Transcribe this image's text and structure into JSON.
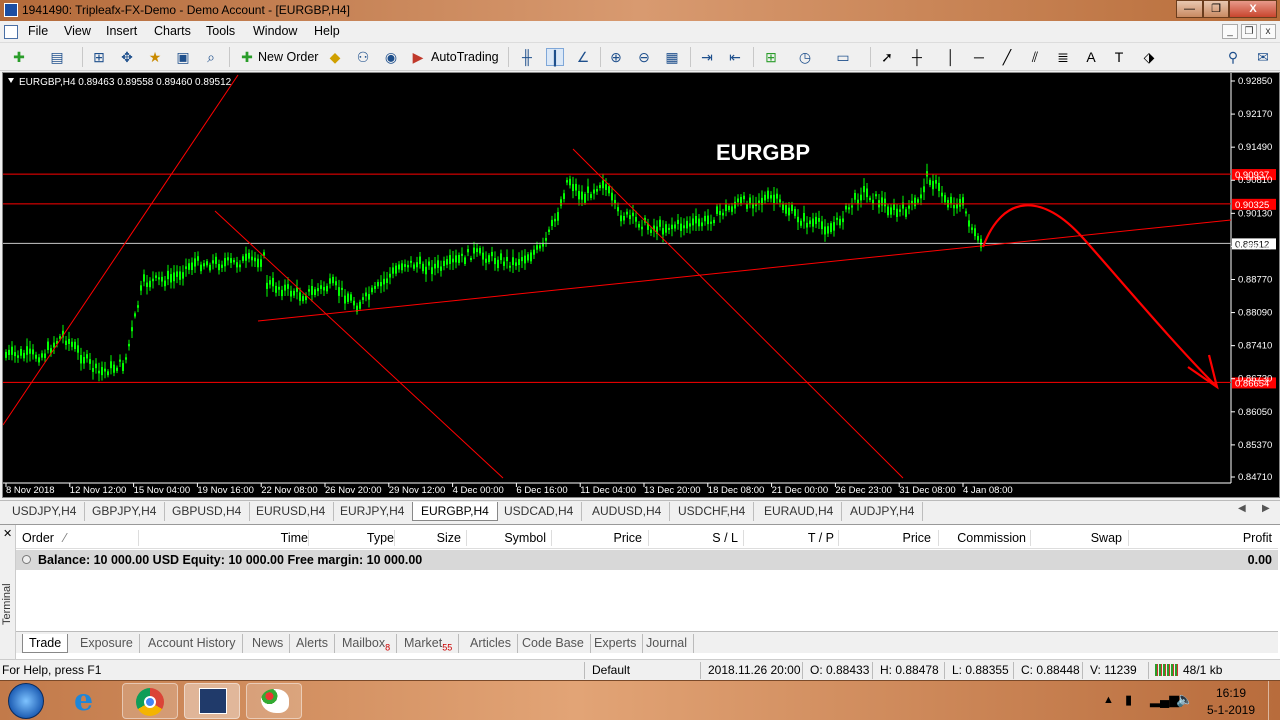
{
  "window": {
    "title": "1941490: Tripleafx-FX-Demo - Demo Account - [EURGBP,H4]",
    "min": "—",
    "max": "❐",
    "close": "X"
  },
  "menu": {
    "file": "File",
    "view": "View",
    "insert": "Insert",
    "charts": "Charts",
    "tools": "Tools",
    "window": "Window",
    "help": "Help"
  },
  "toolbar": {
    "new_order": "New Order",
    "autotrading": "AutoTrading"
  },
  "chart": {
    "header": "EURGBP,H4  0.89463 0.89558 0.89460 0.89512",
    "watermark": "EURGBP",
    "price_labels": [
      "0.92850",
      "0.92170",
      "0.91490",
      "0.90810",
      "0.90130",
      "0.89450",
      "0.88770",
      "0.88090",
      "0.87410",
      "0.86730",
      "0.86050",
      "0.85370",
      "0.84710"
    ],
    "hline_labels": [
      "0.90937",
      "0.90325",
      "0.89512",
      "0.86654"
    ],
    "time_labels": [
      "8 Nov 2018",
      "12 Nov 12:00",
      "15 Nov 04:00",
      "19 Nov 16:00",
      "22 Nov 08:00",
      "26 Nov 20:00",
      "29 Nov 12:00",
      "4 Dec 00:00",
      "6 Dec 16:00",
      "11 Dec 04:00",
      "13 Dec 20:00",
      "18 Dec 08:00",
      "21 Dec 00:00",
      "26 Dec 23:00",
      "31 Dec 08:00",
      "4 Jan 08:00"
    ]
  },
  "colors": {
    "bg": "#000000",
    "candle": "#00ff00",
    "line": "#ff0000",
    "hl_label": "#ff0000",
    "current_label": "#ffffff"
  },
  "symbol_tabs": [
    "USDJPY,H4",
    "GBPJPY,H4",
    "GBPUSD,H4",
    "EURUSD,H4",
    "EURJPY,H4",
    "EURGBP,H4",
    "USDCAD,H4",
    "AUDUSD,H4",
    "USDCHF,H4",
    "EURAUD,H4",
    "AUDJPY,H4"
  ],
  "terminal": {
    "side_label": "Terminal",
    "columns": [
      "Order",
      "Time",
      "Type",
      "Size",
      "Symbol",
      "Price",
      "S / L",
      "T / P",
      "Price",
      "Commission",
      "Swap",
      "Profit"
    ],
    "balance_text": "Balance: 10 000.00 USD  Equity: 10 000.00  Free margin: 10 000.00",
    "profit": "0.00",
    "tabs": [
      {
        "label": "Trade",
        "badge": ""
      },
      {
        "label": "Exposure",
        "badge": ""
      },
      {
        "label": "Account History",
        "badge": ""
      },
      {
        "label": "News",
        "badge": ""
      },
      {
        "label": "Alerts",
        "badge": ""
      },
      {
        "label": "Mailbox",
        "badge": "8"
      },
      {
        "label": "Market",
        "badge": "55"
      },
      {
        "label": "Articles",
        "badge": ""
      },
      {
        "label": "Code Base",
        "badge": ""
      },
      {
        "label": "Experts",
        "badge": ""
      },
      {
        "label": "Journal",
        "badge": ""
      }
    ]
  },
  "status": {
    "help": "For Help, press F1",
    "profile": "Default",
    "datetime": "2018.11.26 20:00",
    "open": "O: 0.88433",
    "high": "H: 0.88478",
    "low": "L: 0.88355",
    "close": "C: 0.88448",
    "volume": "V: 11239",
    "conn": "48/1 kb"
  },
  "tray": {
    "time": "16:19",
    "date": "5-1-2019"
  }
}
